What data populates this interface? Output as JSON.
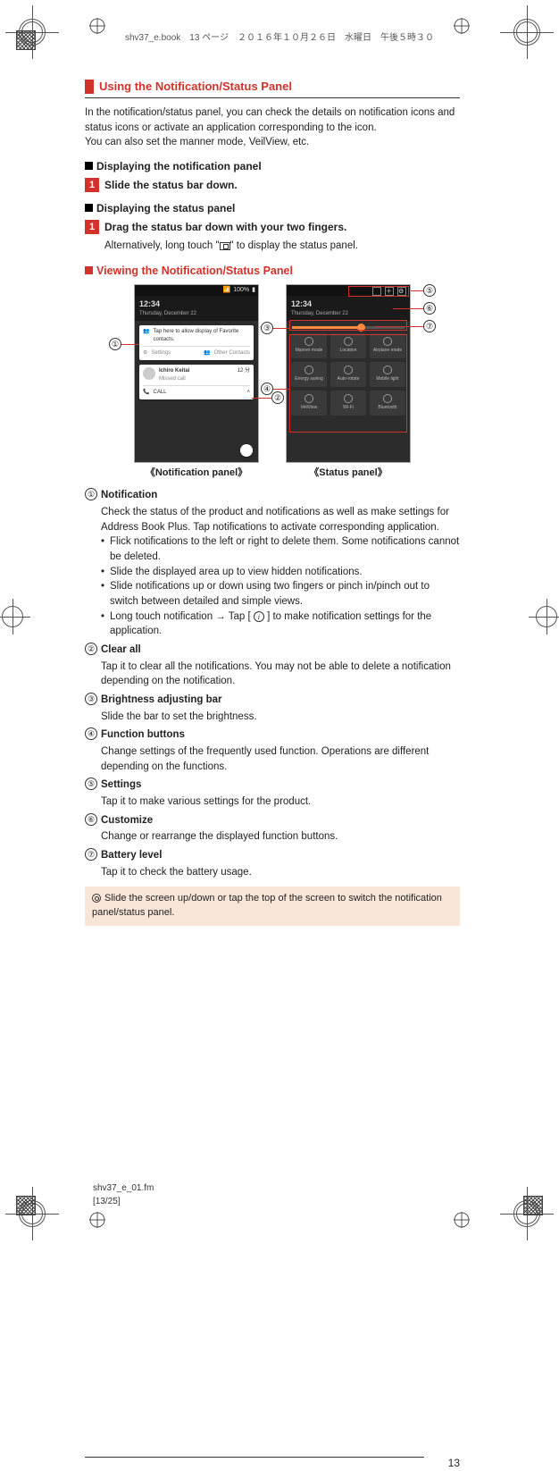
{
  "book_header": "shv37_e.book　13 ページ　２０１６年１０月２６日　水曜日　午後５時３０",
  "footer_file_1": "shv37_e_01.fm",
  "footer_file_2": "[13/25]",
  "page_number": "13",
  "section_title": "Using the Notification/Status Panel",
  "intro_1": "In the notification/status panel, you can check the details on notification icons and status icons or activate an application corresponding to the icon.",
  "intro_2": "You can also set the manner mode, VeilView, etc.",
  "sub_np": "Displaying the notification panel",
  "step_np_1": "Slide the status bar down.",
  "sub_sp": "Displaying the status panel",
  "step_sp_1": "Drag the status bar down with your two fingers.",
  "step_sp_sub_a": "Alternatively, long touch \"",
  "step_sp_sub_b": "\" to display the status panel.",
  "red_sub": "Viewing the Notification/Status Panel",
  "panel_label_left": "《Notification panel》",
  "panel_label_right": "《Status panel》",
  "phone": {
    "signal": "100%",
    "time": "12:34",
    "date": "Thursday, December 22",
    "tap_msg": "Tap here to allow display of Favorite contacts.",
    "settings": "Settings",
    "other": "Other Contacts",
    "person": "Ichiro Keitai",
    "missed": "Missed call",
    "call": "CALL"
  },
  "defs": {
    "d1_t": "Notification",
    "d1_b1": "Check the status of the product and notifications as well as make settings for Address Book Plus. Tap notifications to activate corresponding application.",
    "d1_li1": "Flick notifications to the left or right to delete them. Some notifications cannot be deleted.",
    "d1_li2": "Slide the displayed area up to view hidden notifications.",
    "d1_li3": "Slide notifications up or down using two fingers or pinch in/pinch out to switch between detailed and simple views.",
    "d1_li4a": "Long touch notification → Tap [ ",
    "d1_li4b": " ] to make notification settings for the application.",
    "d2_t": "Clear all",
    "d2_b": "Tap it to clear all the notifications. You may not be able to delete a notification depending on the notification.",
    "d3_t": "Brightness adjusting bar",
    "d3_b": "Slide the bar to set the brightness.",
    "d4_t": "Function buttons",
    "d4_b": "Change settings of the frequently used function. Operations are different depending on the functions.",
    "d5_t": "Settings",
    "d5_b": "Tap it to make various settings for the product.",
    "d6_t": "Customize",
    "d6_b": "Change or rearrange the displayed function buttons.",
    "d7_t": "Battery level",
    "d7_b": "Tap it to check the battery usage."
  },
  "note": "Slide the screen up/down or tap the top of the screen to switch the notification panel/status panel."
}
